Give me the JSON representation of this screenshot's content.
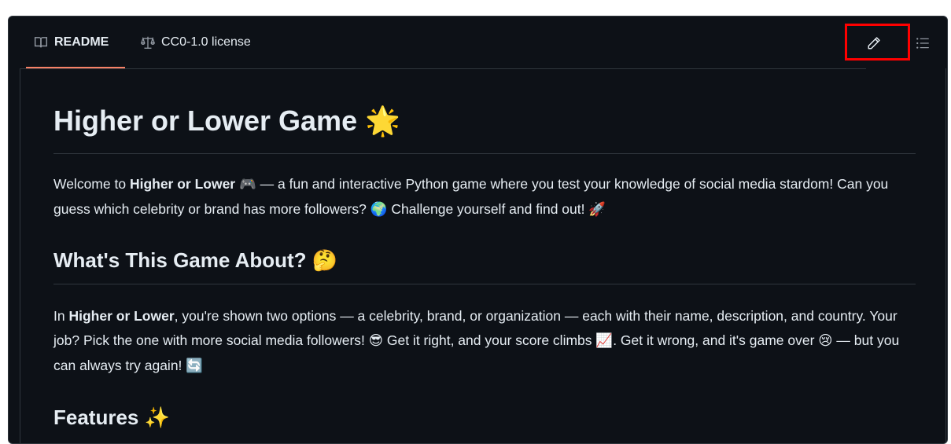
{
  "tabs": {
    "readme": {
      "label": "README",
      "icon": "book-icon",
      "active": true
    },
    "license": {
      "label": "CC0-1.0 license",
      "icon": "scale-icon"
    }
  },
  "toolbar": {
    "edit_icon": "pencil-icon",
    "outline_icon": "list-icon",
    "highlight_color": "#ff0000"
  },
  "readme": {
    "title": "Higher or Lower Game",
    "title_emoji": "🌟",
    "intro": {
      "welcome": "Welcome to ",
      "name": "Higher or Lower",
      "emoji_game": "🎮",
      "text1": " — a fun and interactive Python game where you test your knowledge of social media stardom! Can you guess which celebrity or brand has more followers? ",
      "emoji_globe": "🌍",
      "text2": " Challenge yourself and find out! ",
      "emoji_rocket": "🚀"
    },
    "about": {
      "heading": "What's This Game About?",
      "heading_emoji": "🤔",
      "in": "In ",
      "name": "Higher or Lower",
      "text1": ", you're shown two options — a celebrity, brand, or organization — each with their name, description, and country. Your job? Pick the one with more social media followers! ",
      "emoji_cool": "😎",
      "text2": " Get it right, and your score climbs ",
      "emoji_chart": "📈",
      "text3": ". Get it wrong, and it's game over ",
      "emoji_sad": "😢",
      "text4": " — but you can always try again! ",
      "emoji_repeat": "🔄"
    },
    "features": {
      "heading": "Features",
      "heading_emoji": "✨"
    }
  },
  "colors": {
    "background": "#0d1117",
    "text": "#e6edf3",
    "border": "#30363d",
    "tab_underline": "#f78166",
    "icon": "#9198a1"
  }
}
